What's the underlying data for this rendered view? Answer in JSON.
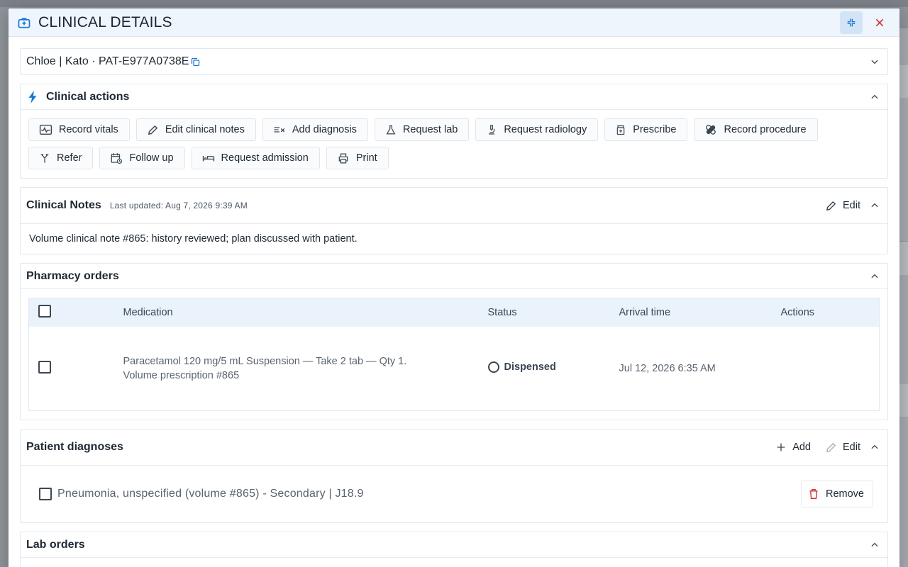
{
  "modal": {
    "title": "CLINICAL DETAILS",
    "icons": {
      "title": "medical-case-icon",
      "collapse": "collapse-arrows-icon",
      "close": "close-icon"
    }
  },
  "patient": {
    "summary": "Chloe | Kato · PAT-E977A0738E",
    "icons": {
      "copy": "copy-icon",
      "expand": "chevron-down-icon"
    }
  },
  "clinical_actions": {
    "title": "Clinical actions",
    "icon": "lightning-icon",
    "buttons": [
      {
        "label": "Record vitals",
        "icon": "vitals-monitor-icon"
      },
      {
        "label": "Edit clinical notes",
        "icon": "pencil-icon"
      },
      {
        "label": "Add diagnosis",
        "icon": "diagnosis-list-icon"
      },
      {
        "label": "Request lab",
        "icon": "flask-icon"
      },
      {
        "label": "Request radiology",
        "icon": "microscope-icon"
      },
      {
        "label": "Prescribe",
        "icon": "pill-bottle-icon"
      },
      {
        "label": "Record procedure",
        "icon": "bandage-icon"
      },
      {
        "label": "Refer",
        "icon": "split-arrow-icon"
      },
      {
        "label": "Follow up",
        "icon": "calendar-clock-icon"
      },
      {
        "label": "Request admission",
        "icon": "bed-icon"
      },
      {
        "label": "Print",
        "icon": "printer-icon"
      }
    ]
  },
  "clinical_notes": {
    "title": "Clinical Notes",
    "updated": "Last updated: Aug 7, 2026 9:39 AM",
    "edit_label": "Edit",
    "body": "Volume clinical note #865: history reviewed; plan discussed with patient."
  },
  "pharmacy_orders": {
    "title": "Pharmacy orders",
    "columns": [
      "Medication",
      "Status",
      "Arrival time",
      "Actions"
    ],
    "rows": [
      {
        "medication_line1": "Paracetamol 120 mg/5 mL Suspension — Take 2 tab — Qty 1.",
        "medication_line2": "Volume prescription #865",
        "status": "Dispensed",
        "arrival": "Jul 12, 2026 6:35 AM"
      }
    ]
  },
  "patient_diagnoses": {
    "title": "Patient diagnoses",
    "add_label": "Add",
    "edit_label": "Edit",
    "items": [
      {
        "text": "Pneumonia, unspecified (volume #865) - Secondary | J18.9",
        "remove_label": "Remove"
      }
    ]
  },
  "lab_orders": {
    "title": "Lab orders"
  },
  "colors": {
    "accent": "#1976d2",
    "header_bg": "#eef5fc",
    "close": "#d32f2f",
    "remove": "#d32f2f"
  }
}
